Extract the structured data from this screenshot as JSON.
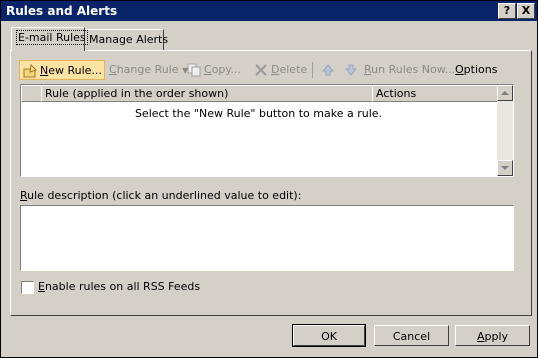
{
  "window": {
    "title": "Rules and Alerts",
    "help_label": "?",
    "close_label": "X"
  },
  "tabs": [
    {
      "label": "E-mail Rules"
    },
    {
      "label": "Manage Alerts"
    }
  ],
  "toolbar": {
    "new_rule": {
      "first": "N",
      "rest": "ew Rule..."
    },
    "change_rule": {
      "first": "C",
      "rest": "hange Rule"
    },
    "copy": {
      "first": "C",
      "rest": "opy..."
    },
    "delete": {
      "first": "D",
      "rest": "elete"
    },
    "run_rules": {
      "first": "R",
      "rest": "un Rules Now..."
    },
    "options": {
      "first": "O",
      "rest": "ptions"
    }
  },
  "rules_list": {
    "columns": [
      {
        "label": "Rule (applied in the order shown)"
      },
      {
        "label": "Actions"
      }
    ],
    "empty_message": "Select the \"New Rule\" button to make a rule."
  },
  "description": {
    "first": "R",
    "rest": "ule description (click an underlined value to edit):"
  },
  "rss": {
    "first": "E",
    "rest": "nable rules on all RSS Feeds",
    "checked": false
  },
  "buttons": {
    "ok": "OK",
    "cancel": "Cancel",
    "apply": {
      "first": "A",
      "rest": "pply"
    }
  }
}
